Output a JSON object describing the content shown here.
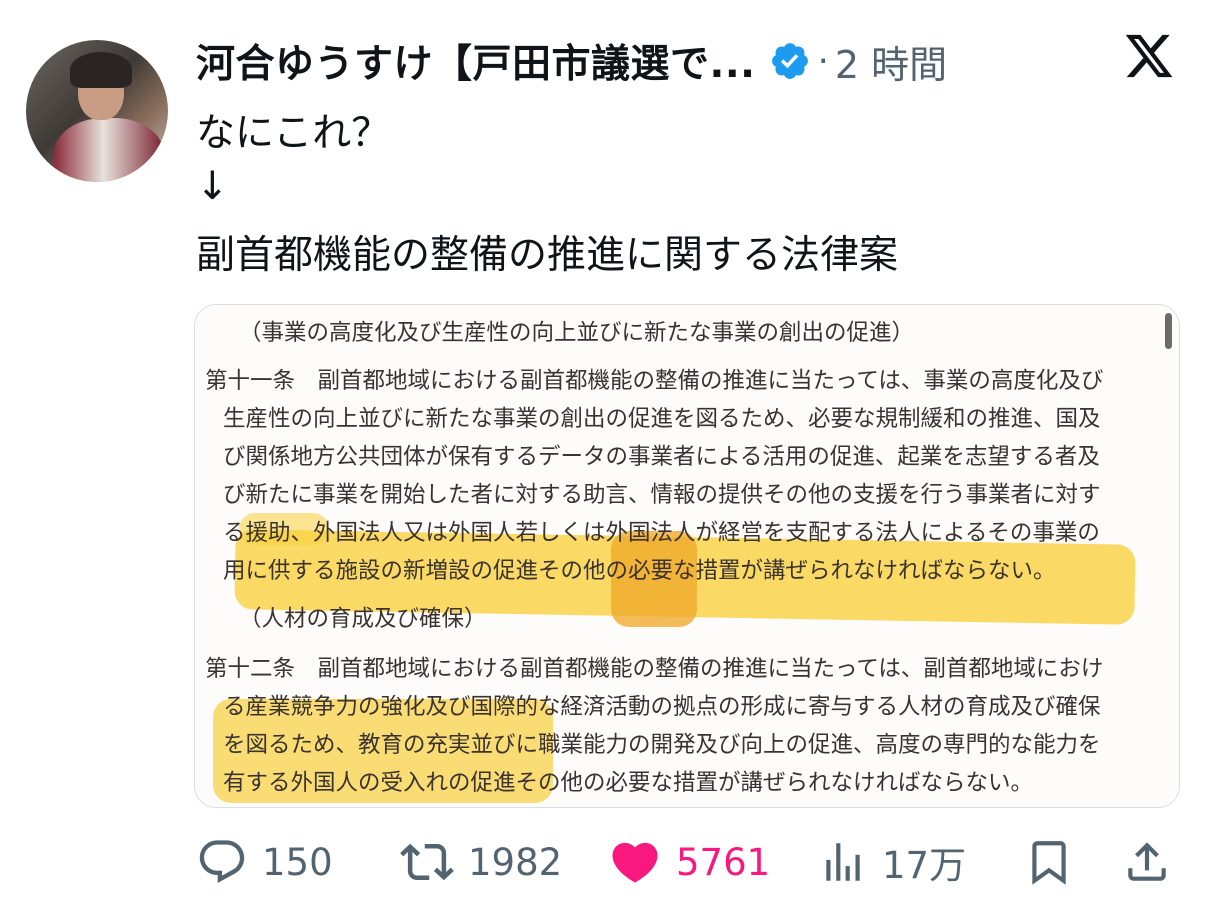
{
  "tweet": {
    "author": "河合ゆうすけ【戸田市議選で...",
    "separator": "·",
    "time": "2 時間",
    "line1": "なにこれ？",
    "line2": "↓",
    "line3": "副首都機能の整備の推進に関する法律案"
  },
  "document": {
    "heading1": "（事業の高度化及び生産性の向上並びに新たな事業の創出の促進）",
    "article11": [
      "第十一条　副首都地域における副首都機能の整備の推進に当たっては、事業の高度化及び",
      "生産性の向上並びに新たな事業の創出の促進を図るため、必要な規制緩和の推進、国及",
      "び関係地方公共団体が保有するデータの事業者による活用の促進、起業を志望する者及",
      "び新たに事業を開始した者に対する助言、情報の提供その他の支援を行う事業者に対す",
      "る援助、外国法人又は外国人若しくは外国法人が経営を支配する法人によるその事業の",
      "用に供する施設の新増設の促進その他の必要な措置が講ぜられなければならない。"
    ],
    "heading2": "（人材の育成及び確保）",
    "article12": [
      "第十二条　副首都地域における副首都機能の整備の推進に当たっては、副首都地域におけ",
      "る産業競争力の強化及び国際的な経済活動の拠点の形成に寄与する人材の育成及び確保",
      "を図るため、教育の充実並びに職業能力の開発及び向上の促進、高度の専門的な能力を",
      "有する外国人の受入れの促進その他の必要な措置が講ぜられなければならない。"
    ]
  },
  "actions": {
    "replies": "150",
    "retweets": "1982",
    "likes": "5761",
    "views": "17万"
  },
  "colors": {
    "text": "#0f1419",
    "secondary": "#536471",
    "verified": "#1d9bf0",
    "like": "#f91880",
    "highlight": "#f8cf3a"
  },
  "icons": [
    "verified-badge-icon",
    "x-logo-icon",
    "reply-icon",
    "retweet-icon",
    "like-icon",
    "views-icon",
    "bookmark-icon",
    "share-icon"
  ]
}
